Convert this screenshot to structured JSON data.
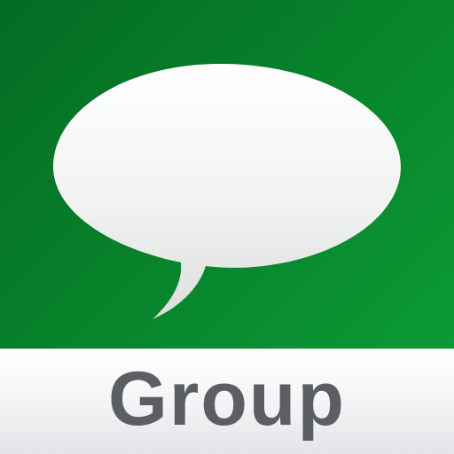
{
  "app_icon": {
    "label": "Group",
    "icon_name": "speech-bubble-icon",
    "colors": {
      "background_green_dark": "#046b23",
      "background_green_light": "#0b9a36",
      "bubble": "#f4f5f4",
      "label_band": "#f3f3f5",
      "label_text": "#5b5e63"
    }
  }
}
